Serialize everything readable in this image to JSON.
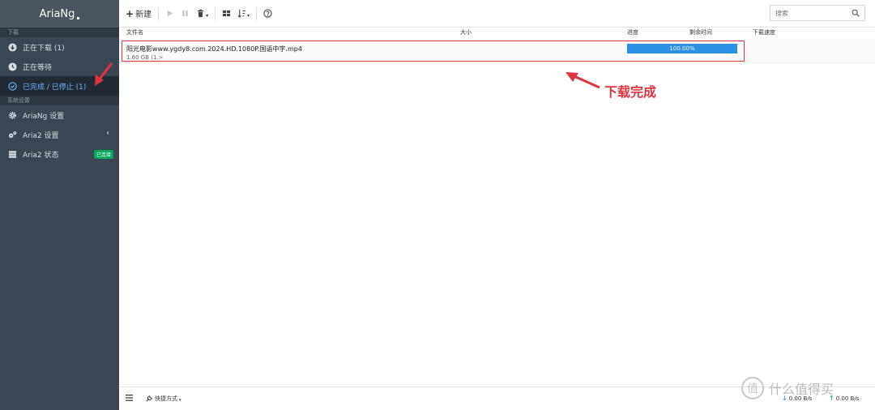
{
  "app": {
    "brand": "AriaNg"
  },
  "sidebar": {
    "section_download": "下载",
    "items": [
      {
        "label": "正在下载 (1)",
        "icon": "download-circle-icon"
      },
      {
        "label": "正在等待",
        "icon": "clock-icon"
      },
      {
        "label": "已完成 / 已停止 (1)",
        "icon": "check-circle-icon"
      }
    ],
    "section_settings": "系统设置",
    "settings_items": [
      {
        "label": "AriaNg 设置",
        "icon": "gear-icon"
      },
      {
        "label": "Aria2 设置",
        "icon": "gears-icon"
      },
      {
        "label": "Aria2 状态",
        "icon": "server-icon",
        "badge": "已连接"
      }
    ]
  },
  "toolbar": {
    "new_label": "新建",
    "search_placeholder": "搜索"
  },
  "table": {
    "headers": {
      "name": "文件名",
      "size": "大小",
      "progress": "进度",
      "remaining": "剩余时间",
      "speed": "下载速度"
    },
    "rows": [
      {
        "name": "阳光电影www.ygdy8.com.2024.HD.1080P.国语中字.mp4",
        "size": "1.60 GB (1.>",
        "progress": "100.00%",
        "progress_value": 100
      }
    ]
  },
  "annotation": {
    "text": "下载完成"
  },
  "footer": {
    "shortcut_label": "快捷方式",
    "download_speed": "0.00 B/s",
    "upload_speed": "0.00 B/s"
  },
  "watermark": {
    "text": "什么值得买",
    "logo": "值"
  },
  "colors": {
    "accent": "#2b8fe3",
    "annotation": "#e03340",
    "sidebar": "#3c4652",
    "badge": "#00a65a"
  }
}
